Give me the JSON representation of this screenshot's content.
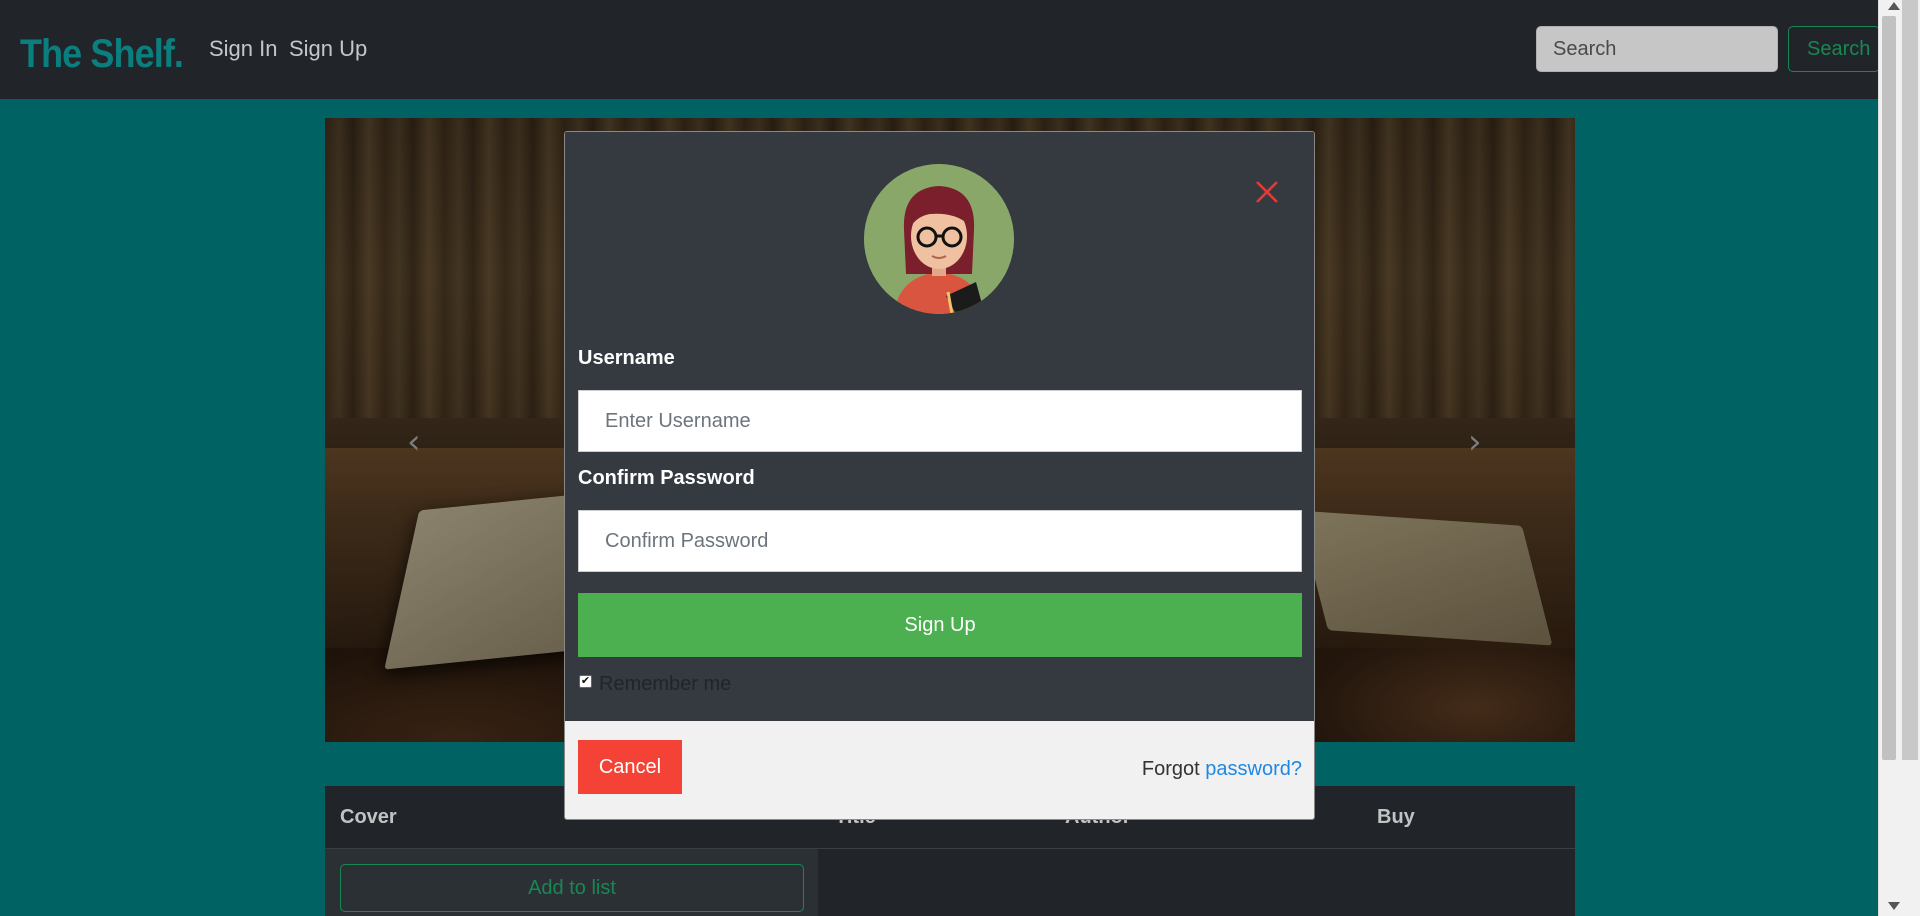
{
  "navbar": {
    "brand": "The Shelf.",
    "links": [
      "Sign In",
      "Sign Up"
    ],
    "search_placeholder": "Search",
    "search_button": "Search"
  },
  "carousel": {
    "prev_icon": "chevron-left-icon",
    "next_icon": "chevron-right-icon"
  },
  "table": {
    "headers": [
      "Cover",
      "Title",
      "Author",
      "Buy"
    ],
    "add_button": "Add to list"
  },
  "modal": {
    "avatar_icon": "librarian-avatar-icon",
    "close_icon": "close-icon",
    "username_label": "Username",
    "username_placeholder": "Enter Username",
    "password_label": "Confirm Password",
    "password_placeholder": "Confirm Password",
    "submit_button": "Sign Up",
    "remember_label": "Remember me",
    "remember_checked": true,
    "cancel_button": "Cancel",
    "forgot_text": "Forgot",
    "forgot_link": "password?"
  },
  "colors": {
    "page_bg": "#006262",
    "navbar_bg": "#212529",
    "brand": "#0b7e7e",
    "success": "#198754",
    "signup_btn": "#4caf50",
    "cancel_btn": "#f44336",
    "link": "#1e88e5",
    "close_icon": "#e53935"
  }
}
